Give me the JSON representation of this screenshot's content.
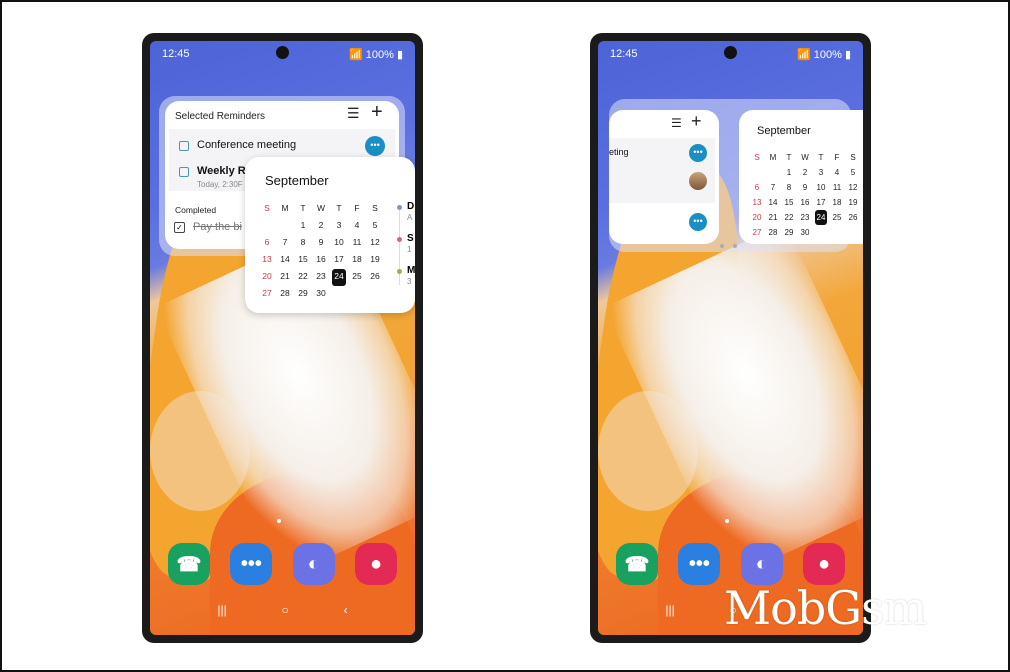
{
  "status": {
    "time": "12:45",
    "battery": "100%"
  },
  "reminders": {
    "title": "Selected Reminders",
    "items": [
      {
        "text": "Conference meeting"
      },
      {
        "text": "Weekly Re",
        "sub": "Today, 2:30F"
      }
    ],
    "completed_label": "Completed",
    "completed_items": [
      {
        "text": "Pay the bi"
      }
    ],
    "right_item_text": "eting"
  },
  "calendar": {
    "month": "September",
    "weekdays": [
      "S",
      "M",
      "T",
      "W",
      "T",
      "F",
      "S"
    ],
    "weeks": [
      [
        "",
        "",
        "1",
        "2",
        "3",
        "4",
        "5"
      ],
      [
        "6",
        "7",
        "8",
        "9",
        "10",
        "11",
        "12"
      ],
      [
        "13",
        "14",
        "15",
        "16",
        "17",
        "18",
        "19"
      ],
      [
        "20",
        "21",
        "22",
        "23",
        "24",
        "25",
        "26"
      ],
      [
        "27",
        "28",
        "29",
        "30",
        "",
        "",
        ""
      ]
    ],
    "today": "24",
    "events": [
      {
        "t": "D",
        "s": "A",
        "color": "#7a9ac8"
      },
      {
        "t": "S",
        "s": "1",
        "color": "#d46a6a"
      },
      {
        "t": "M",
        "s": "3",
        "color": "#9ab050"
      }
    ]
  },
  "dock": [
    {
      "name": "phone",
      "color": "#19a15f"
    },
    {
      "name": "messages",
      "color": "#2a7fe0"
    },
    {
      "name": "internet",
      "color": "#6b72e6"
    },
    {
      "name": "camera",
      "color": "#e32a55"
    }
  ],
  "nav": {
    "recent": "|||",
    "home": "○",
    "back": "‹"
  },
  "watermark": "MobGsm"
}
